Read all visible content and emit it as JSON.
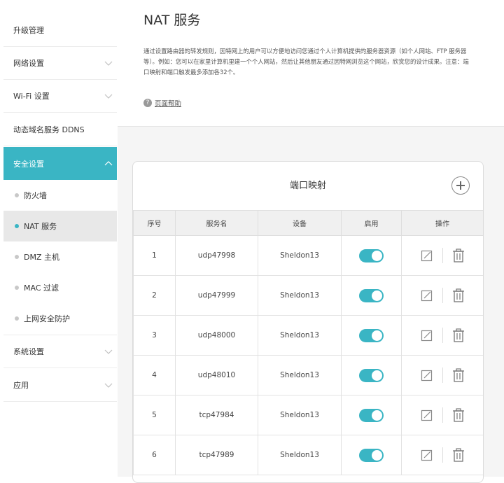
{
  "sidebar": {
    "items": [
      {
        "label": "升级管理"
      },
      {
        "label": "网络设置"
      },
      {
        "label": "Wi-Fi 设置"
      },
      {
        "label": "动态域名服务 DDNS"
      },
      {
        "label": "安全设置"
      },
      {
        "label": "系统设置"
      },
      {
        "label": "应用"
      }
    ],
    "security_sub": [
      {
        "label": "防火墙"
      },
      {
        "label": "NAT 服务"
      },
      {
        "label": "DMZ 主机"
      },
      {
        "label": "MAC 过滤"
      },
      {
        "label": "上网安全防护"
      }
    ]
  },
  "header": {
    "title": "NAT 服务",
    "description": "通过设置路由器的转发规则，因特网上的用户可以方便地访问您通过个人计算机提供的服务器资源（如个人网站、FTP 服务器等）。例如：您可以在家里计算机里建一个个人网站，然后让其他朋友通过因特网浏览这个网站，欣赏您的设计成果。注意：端口映射和端口触发最多添加各32个。",
    "help_label": "页面帮助"
  },
  "card": {
    "title": "端口映射",
    "columns": [
      "序号",
      "服务名",
      "设备",
      "启用",
      "操作"
    ],
    "rows": [
      {
        "no": "1",
        "service": "udp47998",
        "device": "Sheldon13",
        "enabled": true
      },
      {
        "no": "2",
        "service": "udp47999",
        "device": "Sheldon13",
        "enabled": true
      },
      {
        "no": "3",
        "service": "udp48000",
        "device": "Sheldon13",
        "enabled": true
      },
      {
        "no": "4",
        "service": "udp48010",
        "device": "Sheldon13",
        "enabled": true
      },
      {
        "no": "5",
        "service": "tcp47984",
        "device": "Sheldon13",
        "enabled": true
      },
      {
        "no": "6",
        "service": "tcp47989",
        "device": "Sheldon13",
        "enabled": true
      }
    ]
  },
  "colors": {
    "accent": "#3ab5c4"
  }
}
